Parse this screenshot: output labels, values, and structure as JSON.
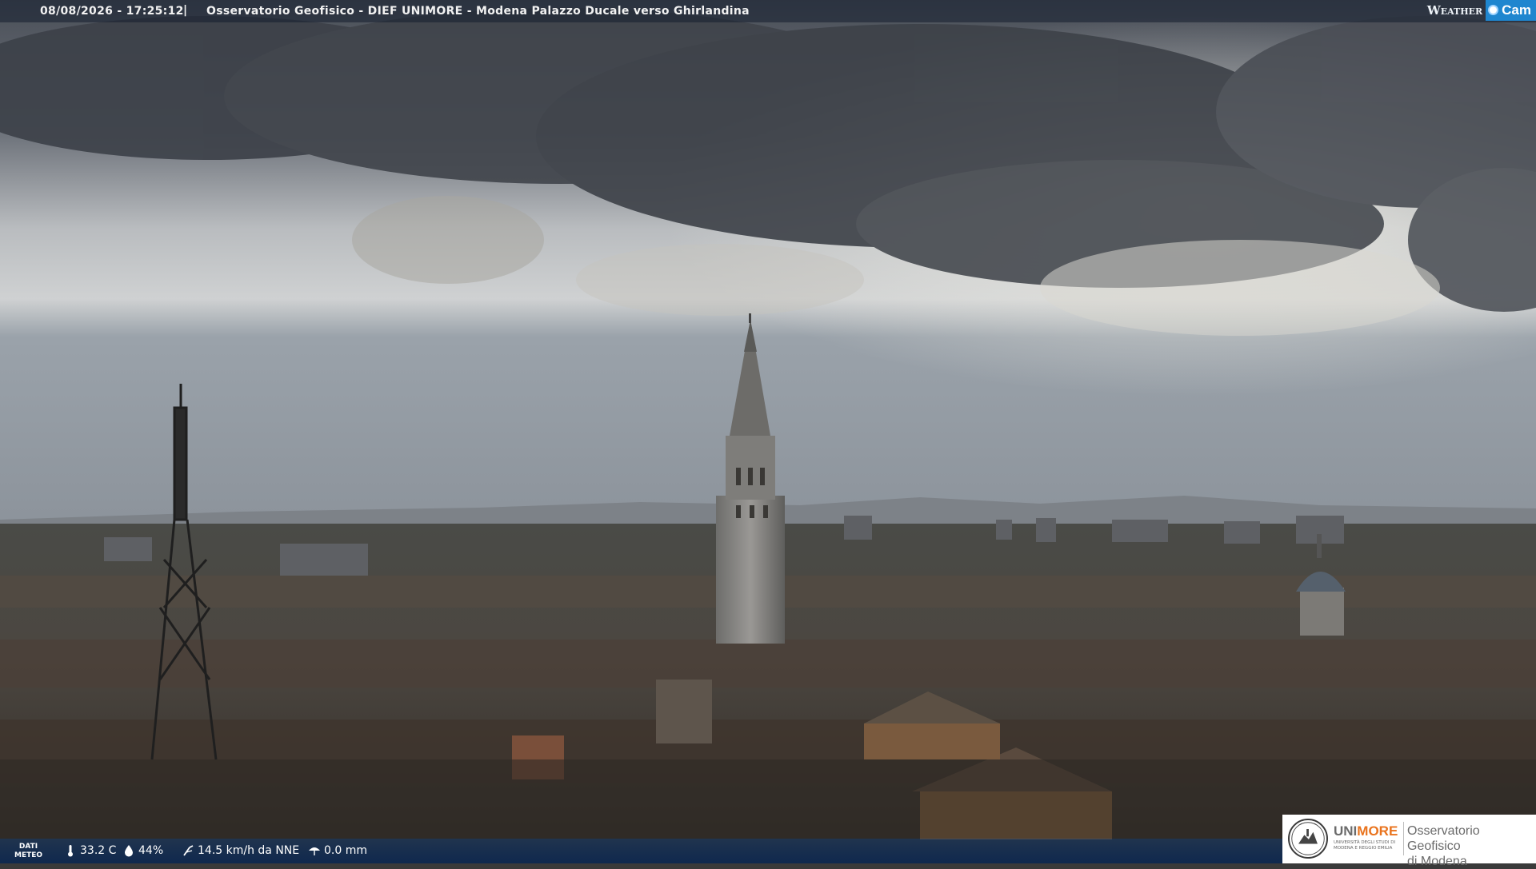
{
  "overlay": {
    "datetime": "08/08/2026 - 17:25:12",
    "separator": "|",
    "title": "Osservatorio Geofisico - DIEF UNIMORE - Modena Palazzo Ducale verso Ghirlandina"
  },
  "brand": {
    "weather_text": "Weather",
    "cam_text": "Cam",
    "cam_color": "#1f86cf"
  },
  "weather_strip": {
    "label_line1": "DATI",
    "label_line2": "METEO",
    "temperature": "33.2 C",
    "temperature_icon": "thermometer-icon",
    "humidity": "44%",
    "humidity_icon": "droplet-icon",
    "wind": "14.5 km/h da NNE",
    "wind_icon": "wind-icon",
    "rain": "0.0 mm",
    "rain_icon": "umbrella-icon"
  },
  "logo": {
    "uni_part1": "UNI",
    "uni_part2": "MORE",
    "uni_sub1": "UNIVERSITÀ DEGLI STUDI DI",
    "uni_sub2": "MODENA E REGGIO EMILIA",
    "observatory_line1": "Osservatorio Geofisico",
    "observatory_line2": "di Modena",
    "accent_color": "#e9731d"
  },
  "scene": {
    "description_icons": [
      "bell-tower",
      "antenna-mast",
      "church-dome",
      "city-rooftops",
      "cloudy-sky"
    ]
  }
}
